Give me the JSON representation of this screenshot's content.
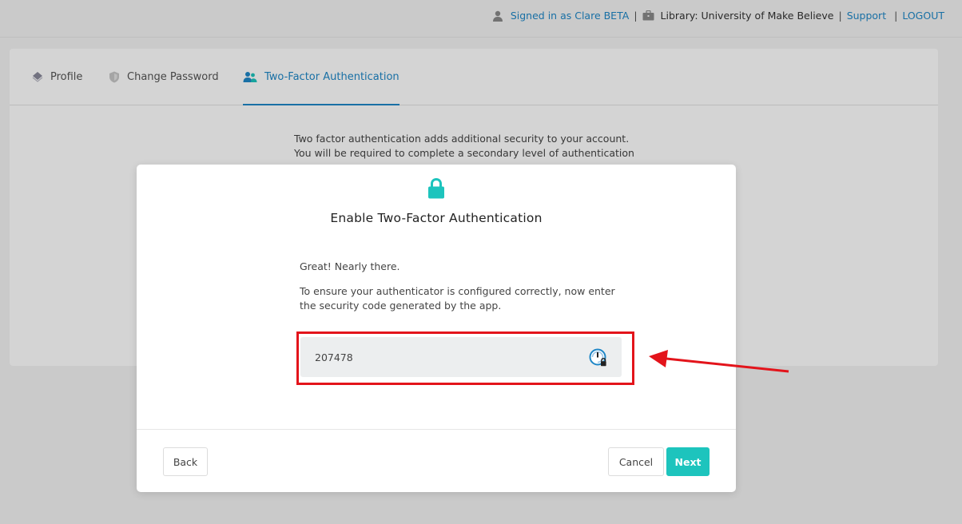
{
  "header": {
    "signed_in": "Signed in as Clare BETA",
    "library": "Library: University of Make Believe",
    "support": "Support",
    "logout": "LOGOUT",
    "separator": "|"
  },
  "tabs": [
    {
      "label": "Profile",
      "icon": "diamond-icon"
    },
    {
      "label": "Change Password",
      "icon": "shield-icon"
    },
    {
      "label": "Two-Factor Authentication",
      "icon": "users-icon",
      "active": true
    }
  ],
  "intro": {
    "line1": "Two factor authentication adds additional security to your account.",
    "line2": "You will be required to complete a secondary level of authentication"
  },
  "modal": {
    "title": "Enable Two-Factor Authentication",
    "message1": "Great! Nearly there.",
    "message2": "To ensure your authenticator is configured correctly, now enter the security code generated by the app.",
    "code_value": "207478",
    "back": "Back",
    "cancel": "Cancel",
    "next": "Next"
  },
  "colors": {
    "accent": "#1f87c7",
    "primary_button": "#1dc4bd",
    "annotation": "#e3141b"
  }
}
